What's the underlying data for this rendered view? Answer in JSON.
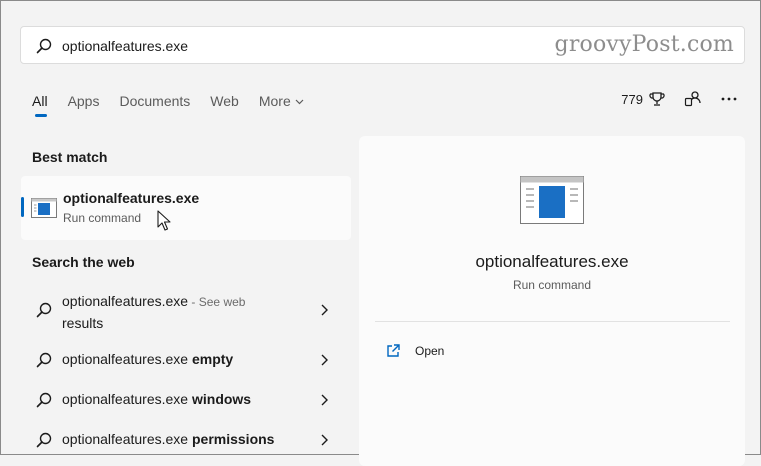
{
  "search": {
    "value": "optionalfeatures.exe",
    "watermark": "groovyPost.com"
  },
  "tabs": [
    {
      "label": "All",
      "active": true
    },
    {
      "label": "Apps"
    },
    {
      "label": "Documents"
    },
    {
      "label": "Web"
    },
    {
      "label": "More"
    }
  ],
  "toolbar": {
    "points": "779",
    "icons": [
      "rewards-trophy-icon",
      "account-switch-icon",
      "more-options-icon"
    ]
  },
  "best_match": {
    "section_label": "Best match",
    "title": "optionalfeatures.exe",
    "subtitle": "Run command"
  },
  "web": {
    "section_label": "Search the web",
    "items": [
      {
        "text": "optionalfeatures.exe",
        "note": " - See web",
        "note2": "results",
        "bold": ""
      },
      {
        "text": "optionalfeatures.exe ",
        "bold": "empty"
      },
      {
        "text": "optionalfeatures.exe ",
        "bold": "windows"
      },
      {
        "text": "optionalfeatures.exe ",
        "bold": "permissions"
      }
    ]
  },
  "preview": {
    "title": "optionalfeatures.exe",
    "subtitle": "Run command",
    "actions": [
      {
        "label": "Open",
        "icon": "open-external-icon"
      }
    ]
  },
  "colors": {
    "accent": "#0067c0",
    "background": "#f3f3f3",
    "panel": "#fbfbfb"
  }
}
